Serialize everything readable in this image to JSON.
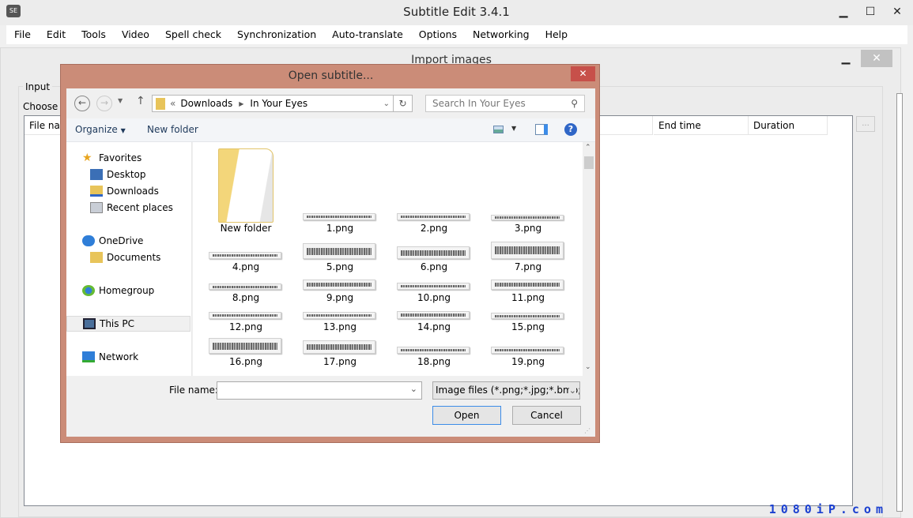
{
  "app": {
    "title": "Subtitle Edit 3.4.1",
    "icon_text": "SE"
  },
  "menu": [
    "File",
    "Edit",
    "Tools",
    "Video",
    "Spell check",
    "Synchronization",
    "Auto-translate",
    "Options",
    "Networking",
    "Help"
  ],
  "import_window": {
    "title": "Import images",
    "group_label": "Input",
    "choose_label": "Choose in",
    "columns": [
      "File nam",
      "End time",
      "Duration"
    ],
    "browse_label": "..."
  },
  "dialog": {
    "title": "Open subtitle...",
    "close": "✕",
    "breadcrumb": {
      "prefix": "«",
      "items": [
        "Downloads",
        "In Your Eyes"
      ]
    },
    "search_placeholder": "Search In Your Eyes",
    "toolbar": {
      "organize": "Organize",
      "new_folder": "New folder"
    },
    "nav": {
      "favorites": "Favorites",
      "desktop": "Desktop",
      "downloads": "Downloads",
      "recent": "Recent places",
      "onedrive": "OneDrive",
      "documents": "Documents",
      "homegroup": "Homegroup",
      "thispc": "This PC",
      "network": "Network"
    },
    "files": [
      "New folder",
      "1.png",
      "2.png",
      "3.png",
      "4.png",
      "5.png",
      "6.png",
      "7.png",
      "8.png",
      "9.png",
      "10.png",
      "11.png",
      "12.png",
      "13.png",
      "14.png",
      "15.png",
      "16.png",
      "17.png",
      "18.png",
      "19.png"
    ],
    "file_name_label": "File name:",
    "file_name_value": "",
    "file_type": "Image files (*.png;*.jpg;*.bmp;*",
    "open": "Open",
    "cancel": "Cancel"
  },
  "watermark": "1080iP.com",
  "colors": {
    "dialog_frame": "#cb8c78",
    "close_red": "#c7504a",
    "accent": "#3c8ce8"
  }
}
